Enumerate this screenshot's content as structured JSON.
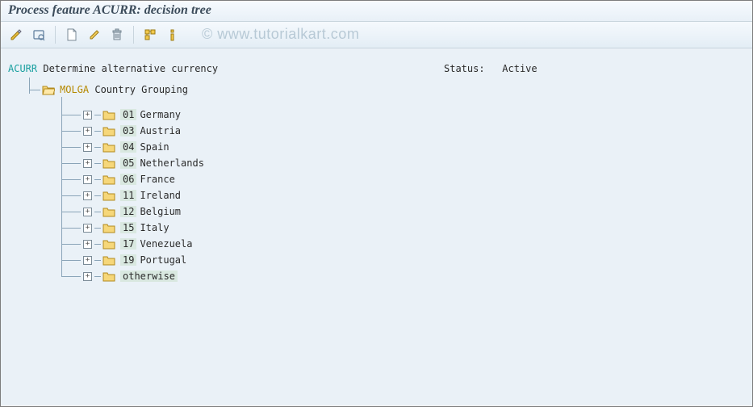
{
  "title": "Process feature ACURR: decision tree",
  "watermark": "© www.tutorialkart.com",
  "root": {
    "code": "ACURR",
    "description": "Determine alternative currency"
  },
  "status_label": "Status:",
  "status_value": "Active",
  "group": {
    "code": "MOLGA",
    "description": "Country Grouping"
  },
  "children": [
    {
      "code": "01",
      "label": "Germany"
    },
    {
      "code": "03",
      "label": "Austria"
    },
    {
      "code": "04",
      "label": "Spain"
    },
    {
      "code": "05",
      "label": "Netherlands"
    },
    {
      "code": "06",
      "label": "France"
    },
    {
      "code": "11",
      "label": "Ireland"
    },
    {
      "code": "12",
      "label": "Belgium"
    },
    {
      "code": "15",
      "label": "Italy"
    },
    {
      "code": "17",
      "label": "Venezuela"
    },
    {
      "code": "19",
      "label": "Portugal"
    },
    {
      "code": "otherwise",
      "label": ""
    }
  ],
  "toolbar_icons": {
    "change": "change-icon",
    "check": "check-icon",
    "create": "create-icon",
    "edit": "edit-icon",
    "delete": "delete-icon",
    "expand": "expand-icon",
    "info": "info-icon"
  }
}
